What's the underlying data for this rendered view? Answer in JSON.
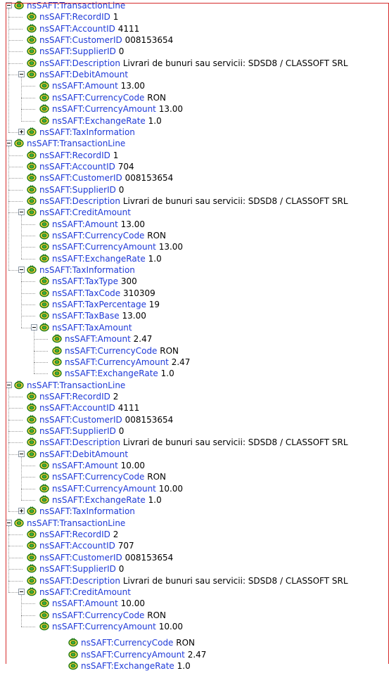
{
  "tree": {
    "nodes": [
      {
        "depth": 0,
        "tag": "nsSAFT:TransactionLine",
        "value": "",
        "toggle": "minus"
      },
      {
        "depth": 1,
        "tag": "nsSAFT:RecordID",
        "value": "1",
        "toggle": ""
      },
      {
        "depth": 1,
        "tag": "nsSAFT:AccountID",
        "value": "4111",
        "toggle": ""
      },
      {
        "depth": 1,
        "tag": "nsSAFT:CustomerID",
        "value": "008153654",
        "toggle": ""
      },
      {
        "depth": 1,
        "tag": "nsSAFT:SupplierID",
        "value": "0",
        "toggle": ""
      },
      {
        "depth": 1,
        "tag": "nsSAFT:Description",
        "value": "Livrari de bunuri sau servicii: SDSD8 / CLASSOFT SRL",
        "toggle": ""
      },
      {
        "depth": 1,
        "tag": "nsSAFT:DebitAmount",
        "value": "",
        "toggle": "minus"
      },
      {
        "depth": 2,
        "tag": "nsSAFT:Amount",
        "value": "13.00",
        "toggle": ""
      },
      {
        "depth": 2,
        "tag": "nsSAFT:CurrencyCode",
        "value": "RON",
        "toggle": ""
      },
      {
        "depth": 2,
        "tag": "nsSAFT:CurrencyAmount",
        "value": "13.00",
        "toggle": ""
      },
      {
        "depth": 2,
        "tag": "nsSAFT:ExchangeRate",
        "value": "1.0",
        "toggle": ""
      },
      {
        "depth": 1,
        "tag": "nsSAFT:TaxInformation",
        "value": "",
        "toggle": "plus"
      },
      {
        "depth": 0,
        "tag": "nsSAFT:TransactionLine",
        "value": "",
        "toggle": "minus"
      },
      {
        "depth": 1,
        "tag": "nsSAFT:RecordID",
        "value": "1",
        "toggle": ""
      },
      {
        "depth": 1,
        "tag": "nsSAFT:AccountID",
        "value": "704",
        "toggle": ""
      },
      {
        "depth": 1,
        "tag": "nsSAFT:CustomerID",
        "value": "008153654",
        "toggle": ""
      },
      {
        "depth": 1,
        "tag": "nsSAFT:SupplierID",
        "value": "0",
        "toggle": ""
      },
      {
        "depth": 1,
        "tag": "nsSAFT:Description",
        "value": "Livrari de bunuri sau servicii: SDSD8 /  CLASSOFT SRL",
        "toggle": ""
      },
      {
        "depth": 1,
        "tag": "nsSAFT:CreditAmount",
        "value": "",
        "toggle": "minus"
      },
      {
        "depth": 2,
        "tag": "nsSAFT:Amount",
        "value": "13.00",
        "toggle": ""
      },
      {
        "depth": 2,
        "tag": "nsSAFT:CurrencyCode",
        "value": "RON",
        "toggle": ""
      },
      {
        "depth": 2,
        "tag": "nsSAFT:CurrencyAmount",
        "value": "13.00",
        "toggle": ""
      },
      {
        "depth": 2,
        "tag": "nsSAFT:ExchangeRate",
        "value": "1.0",
        "toggle": ""
      },
      {
        "depth": 1,
        "tag": "nsSAFT:TaxInformation",
        "value": "",
        "toggle": "minus"
      },
      {
        "depth": 2,
        "tag": "nsSAFT:TaxType",
        "value": "300",
        "toggle": ""
      },
      {
        "depth": 2,
        "tag": "nsSAFT:TaxCode",
        "value": "310309",
        "toggle": ""
      },
      {
        "depth": 2,
        "tag": "nsSAFT:TaxPercentage",
        "value": "19",
        "toggle": ""
      },
      {
        "depth": 2,
        "tag": "nsSAFT:TaxBase",
        "value": "13.00",
        "toggle": ""
      },
      {
        "depth": 2,
        "tag": "nsSAFT:TaxAmount",
        "value": "",
        "toggle": "minus"
      },
      {
        "depth": 3,
        "tag": "nsSAFT:Amount",
        "value": "2.47",
        "toggle": ""
      },
      {
        "depth": 3,
        "tag": "nsSAFT:CurrencyCode",
        "value": "RON",
        "toggle": ""
      },
      {
        "depth": 3,
        "tag": "nsSAFT:CurrencyAmount",
        "value": "2.47",
        "toggle": ""
      },
      {
        "depth": 3,
        "tag": "nsSAFT:ExchangeRate",
        "value": "1.0",
        "toggle": ""
      },
      {
        "depth": 0,
        "tag": "nsSAFT:TransactionLine",
        "value": "",
        "toggle": "minus"
      },
      {
        "depth": 1,
        "tag": "nsSAFT:RecordID",
        "value": "2",
        "toggle": ""
      },
      {
        "depth": 1,
        "tag": "nsSAFT:AccountID",
        "value": "4111",
        "toggle": ""
      },
      {
        "depth": 1,
        "tag": "nsSAFT:CustomerID",
        "value": "008153654",
        "toggle": ""
      },
      {
        "depth": 1,
        "tag": "nsSAFT:SupplierID",
        "value": "0",
        "toggle": ""
      },
      {
        "depth": 1,
        "tag": "nsSAFT:Description",
        "value": "Livrari de bunuri sau servicii: SDSD8 /  CLASSOFT SRL",
        "toggle": ""
      },
      {
        "depth": 1,
        "tag": "nsSAFT:DebitAmount",
        "value": "",
        "toggle": "minus"
      },
      {
        "depth": 2,
        "tag": "nsSAFT:Amount",
        "value": "10.00",
        "toggle": ""
      },
      {
        "depth": 2,
        "tag": "nsSAFT:CurrencyCode",
        "value": "RON",
        "toggle": ""
      },
      {
        "depth": 2,
        "tag": "nsSAFT:CurrencyAmount",
        "value": "10.00",
        "toggle": ""
      },
      {
        "depth": 2,
        "tag": "nsSAFT:ExchangeRate",
        "value": "1.0",
        "toggle": ""
      },
      {
        "depth": 1,
        "tag": "nsSAFT:TaxInformation",
        "value": "",
        "toggle": "plus"
      },
      {
        "depth": 0,
        "tag": "nsSAFT:TransactionLine",
        "value": "",
        "toggle": "minus"
      },
      {
        "depth": 1,
        "tag": "nsSAFT:RecordID",
        "value": "2",
        "toggle": ""
      },
      {
        "depth": 1,
        "tag": "nsSAFT:AccountID",
        "value": "707",
        "toggle": ""
      },
      {
        "depth": 1,
        "tag": "nsSAFT:CustomerID",
        "value": "008153654",
        "toggle": ""
      },
      {
        "depth": 1,
        "tag": "nsSAFT:SupplierID",
        "value": "0",
        "toggle": ""
      },
      {
        "depth": 1,
        "tag": "nsSAFT:Description",
        "value": "Livrari de bunuri sau servicii: SDSD8 /  CLASSOFT SRL",
        "toggle": ""
      },
      {
        "depth": 1,
        "tag": "nsSAFT:CreditAmount",
        "value": "",
        "toggle": "minus"
      },
      {
        "depth": 2,
        "tag": "nsSAFT:Amount",
        "value": "10.00",
        "toggle": ""
      },
      {
        "depth": 2,
        "tag": "nsSAFT:CurrencyCode",
        "value": "RON",
        "toggle": ""
      },
      {
        "depth": 2,
        "tag": "nsSAFT:CurrencyAmount",
        "value": "10.00",
        "toggle": ""
      },
      {
        "depth": 3,
        "tag": "nsSAFT:CurrencyCode",
        "value": "RON",
        "toggle": ""
      },
      {
        "depth": 3,
        "tag": "nsSAFT:CurrencyAmount",
        "value": "2.47",
        "toggle": ""
      },
      {
        "depth": 3,
        "tag": "nsSAFT:ExchangeRate",
        "value": "1.0",
        "toggle": ""
      }
    ]
  },
  "colors": {
    "tag": "#1f3ad8",
    "value": "#000000",
    "frame": "#d52b2b",
    "connector": "#9a9a9a"
  },
  "icons": {
    "element": "xml-element-icon",
    "expander": "tree-expander-icon"
  }
}
